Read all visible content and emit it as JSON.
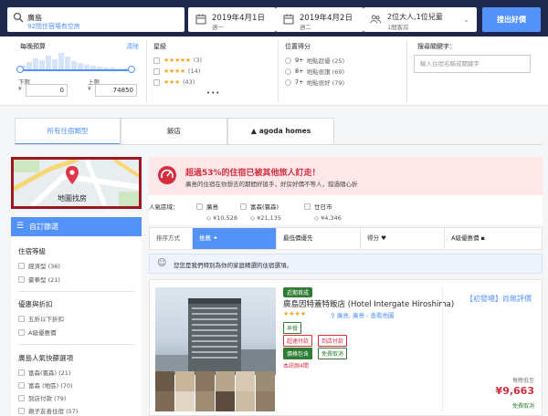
{
  "search": {
    "destination": "廣島",
    "destination_sub": "92間住宿場有空房",
    "checkin": "2019年4月1日",
    "checkin_day": "週一",
    "checkout": "2019年4月2日",
    "checkout_day": "週二",
    "occupancy": "2位大人,1位兒童",
    "rooms": "1間客房",
    "submit_label": "搜出好價"
  },
  "filters": {
    "budget": {
      "title": "每晚預算",
      "clear_label": "清除",
      "min_label": "下限",
      "max_label": "上限",
      "currency": "¥",
      "min_value": "0",
      "max_value": "74850"
    },
    "stars": {
      "title": "星級",
      "rows": [
        {
          "stars": "★★★★★",
          "count": "(3)"
        },
        {
          "stars": "★★★★",
          "count": "(14)"
        },
        {
          "stars": "★★★",
          "count": "(43)"
        }
      ],
      "more": "•••"
    },
    "location": {
      "title": "位置得分",
      "rows": [
        {
          "score": "9+",
          "text": "地點超優 (25)"
        },
        {
          "score": "8+",
          "text": "地點很讚 (69)"
        },
        {
          "score": "7+",
          "text": "地點很好 (79)"
        }
      ]
    },
    "keyword": {
      "title": "搜尋關鍵字：",
      "placeholder": "輸入住宿名稱或關鍵字"
    }
  },
  "tabs": [
    {
      "label": "所有住宿類型"
    },
    {
      "label": "飯店"
    },
    {
      "label": "agoda homes"
    }
  ],
  "sidebar": {
    "map_label": "地圖找房",
    "custom_filter": "自訂篩選",
    "sections": [
      {
        "title": "住宿等級",
        "items": [
          "經濟型 (36)",
          "豪華型 (21)"
        ]
      },
      {
        "title": "優惠與折扣",
        "items": [
          "五折以下折扣",
          "A級優惠價"
        ]
      },
      {
        "title": "廣島人氣快篩選項",
        "items": [
          "富森(寰森) (21)",
          "富森 (地區) (70)",
          "到店付款 (79)",
          "親子友善住宿 (57)"
        ]
      }
    ]
  },
  "alert": {
    "headline": "超過53%的住宿已被其他旅人訂走！",
    "subtext": "廣島的住宿在你想去的期間好搶手，好房好價不等人，錯過隨心折"
  },
  "popular_areas": {
    "label": "人氣區域：",
    "items": [
      {
        "name": "廣島",
        "price": "¥10,528"
      },
      {
        "name": "富森(寰森)",
        "price": "¥21,135"
      },
      {
        "name": "廿日市",
        "price": "¥4,346"
      }
    ]
  },
  "sort": {
    "label": "排序方式",
    "options": [
      "推薦",
      "最低價優先",
      "得分",
      "A級優惠價"
    ]
  },
  "notice": "您您是我們特別為你的家庭精選的住宿選項。",
  "hotel": {
    "badge": "近期首成",
    "name": "廣島因特蓋特飯店 (Hotel Intergate Hiroshima)",
    "stars": "★★★★",
    "location": "廣島, 廣島 - 查看地圖",
    "tags": [
      "早餐",
      "超速付款",
      "到店付款",
      "價格包含",
      "免費取消"
    ],
    "booked": "本訊剛4間",
    "promo": "【初發場】尚無評價",
    "per_night": "每晚低至",
    "price": "¥9,663",
    "free_cancel": "免費取消"
  },
  "colors": {
    "header_bg": "#20274d",
    "accent": "#5392f9",
    "alert_red": "#d32f3e",
    "highlight_border": "#a01620"
  }
}
